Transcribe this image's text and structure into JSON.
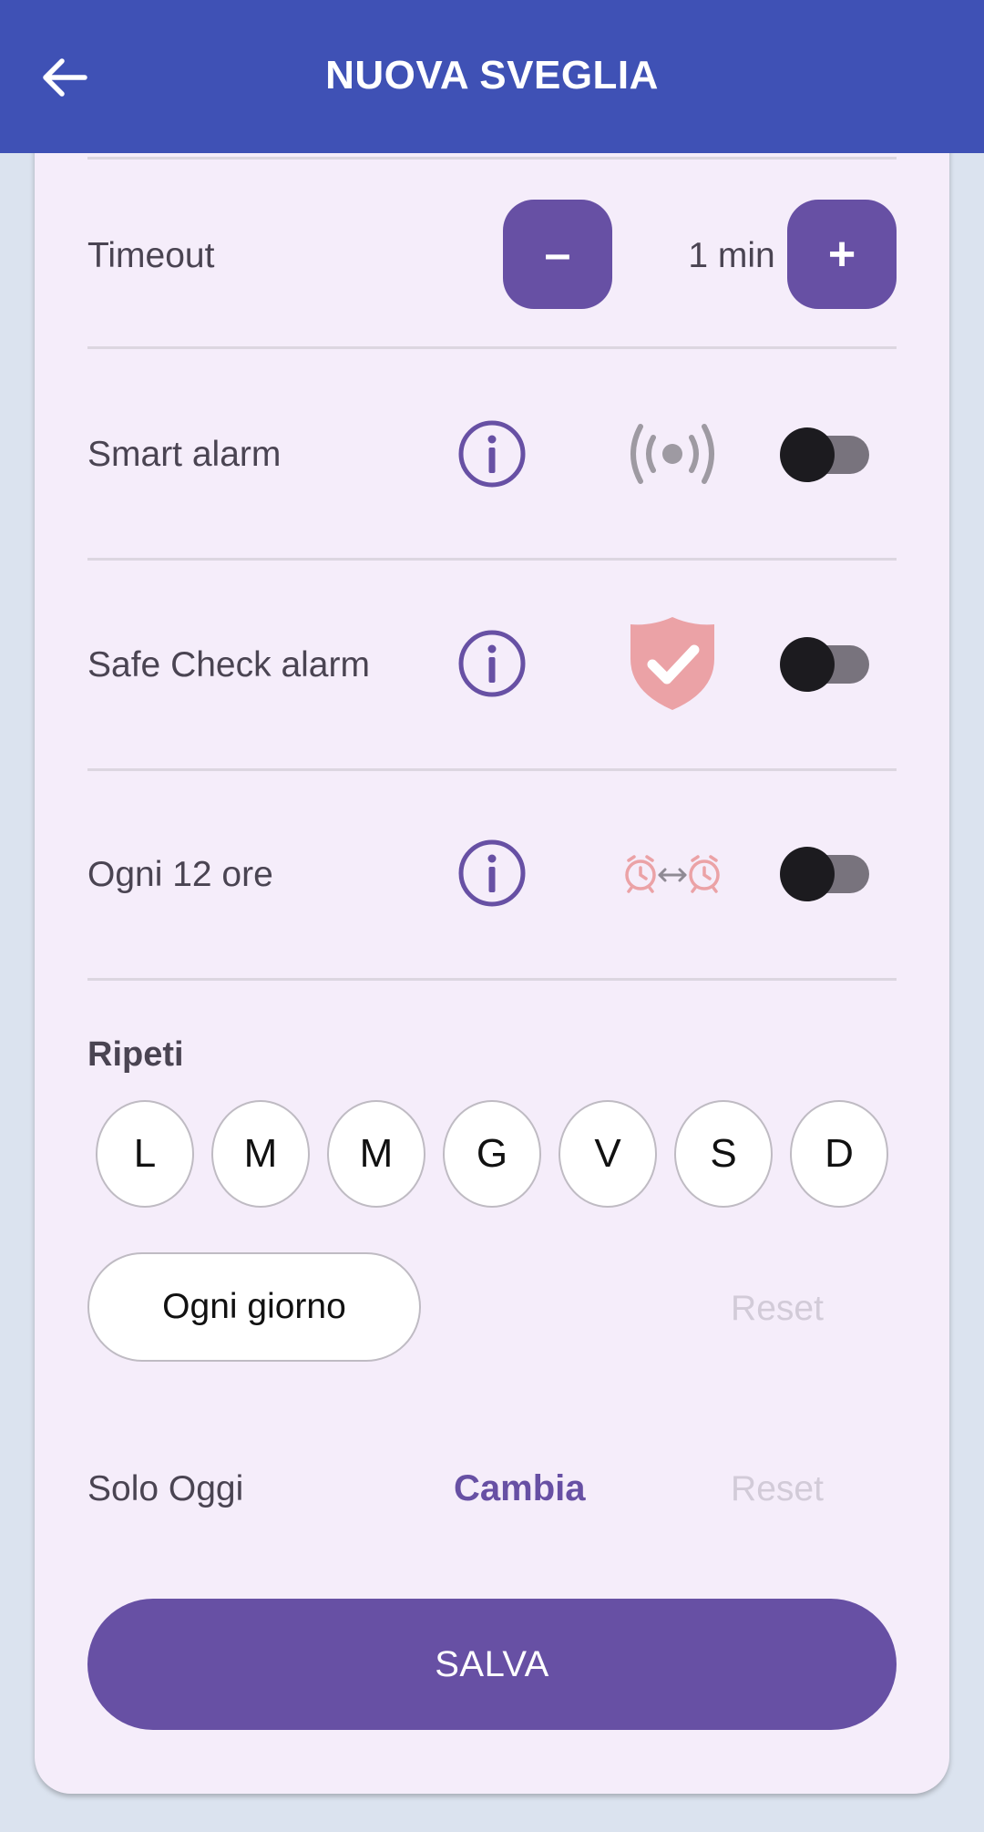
{
  "header": {
    "title": "NUOVA SVEGLIA",
    "back_icon": "arrow-left-icon",
    "background": "#3f51b5"
  },
  "timeout": {
    "label": "Timeout",
    "decrement_label": "–",
    "value": "1 min",
    "increment_label": "+"
  },
  "smart_alarm": {
    "label": "Smart alarm",
    "info_icon": "info-icon",
    "feature_icon": "vibration-signal-icon",
    "enabled": false
  },
  "safe_check": {
    "label": "Safe Check alarm",
    "info_icon": "info-icon",
    "feature_icon": "shield-check-icon",
    "enabled": false
  },
  "every_12h": {
    "label": "Ogni 12 ore",
    "info_icon": "info-icon",
    "feature_icon": "alarm-clocks-exchange-icon",
    "enabled": false
  },
  "repeat": {
    "title": "Ripeti",
    "days": [
      "L",
      "M",
      "M",
      "G",
      "V",
      "S",
      "D"
    ],
    "every_day_label": "Ogni giorno",
    "reset_label": "Reset"
  },
  "only_today": {
    "label": "Solo Oggi",
    "change_label": "Cambia",
    "reset_label": "Reset"
  },
  "save_label": "SALVA",
  "colors": {
    "accent": "#6750a4",
    "card_background": "#f5edfa",
    "page_background": "#dbe3ef",
    "shield": "#eba2a6",
    "disabled_text": "#d2cbd8"
  }
}
